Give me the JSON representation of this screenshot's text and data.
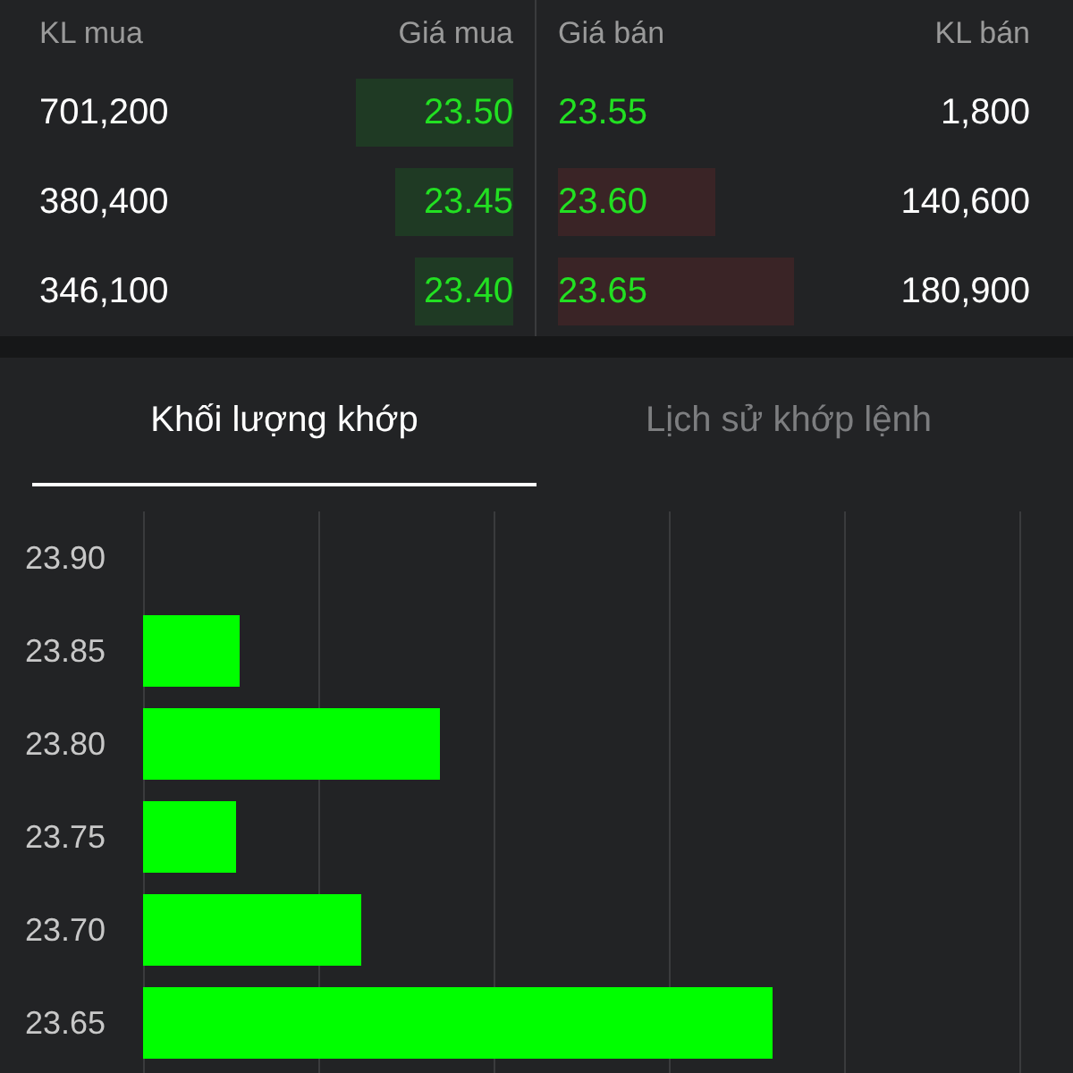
{
  "order_book": {
    "columns": [
      "KL mua",
      "Giá mua",
      "Giá bán",
      "KL bán"
    ],
    "rows": [
      {
        "buy_volume": "701,200",
        "buy_price": "23.50",
        "sell_price": "23.55",
        "sell_volume": "1,800"
      },
      {
        "buy_volume": "380,400",
        "buy_price": "23.45",
        "sell_price": "23.60",
        "sell_volume": "140,600"
      },
      {
        "buy_volume": "346,100",
        "buy_price": "23.40",
        "sell_price": "23.65",
        "sell_volume": "180,900"
      }
    ]
  },
  "tabs": [
    {
      "label": "Khối lượng khớp",
      "selected": true
    },
    {
      "label": "Lịch sử khớp lệnh",
      "selected": false
    }
  ],
  "volume_chart": {
    "price_levels": [
      "23.90",
      "23.85",
      "23.80",
      "23.75",
      "23.70",
      "23.65"
    ]
  }
}
